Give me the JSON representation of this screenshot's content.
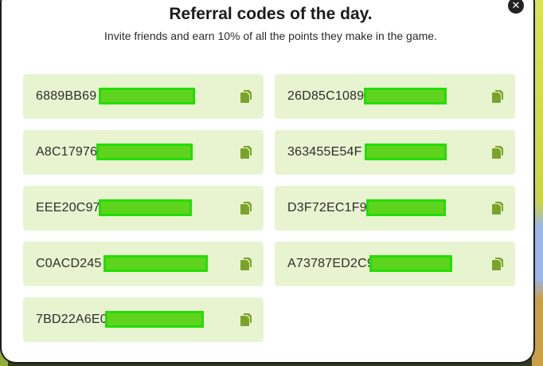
{
  "modal": {
    "title": "Referral codes of the day.",
    "subtitle": "Invite friends and earn 10% of all the points they make in the game."
  },
  "close_icon": "close-icon",
  "copy_icon": "copy-icon",
  "colors": {
    "card_background": "#e8f4d0",
    "copy_icon": "#7aa32a",
    "redaction_box": "#22dd00"
  },
  "codes": [
    {
      "visible": "6889BB69"
    },
    {
      "visible": "26D85C1089"
    },
    {
      "visible": "A8C17976"
    },
    {
      "visible": "363455E54F"
    },
    {
      "visible": "EEE20C97"
    },
    {
      "visible": "D3F72EC1F9"
    },
    {
      "visible": "C0ACD245"
    },
    {
      "visible": "A73787ED2C9"
    },
    {
      "visible": "7BD22A6E0"
    }
  ]
}
